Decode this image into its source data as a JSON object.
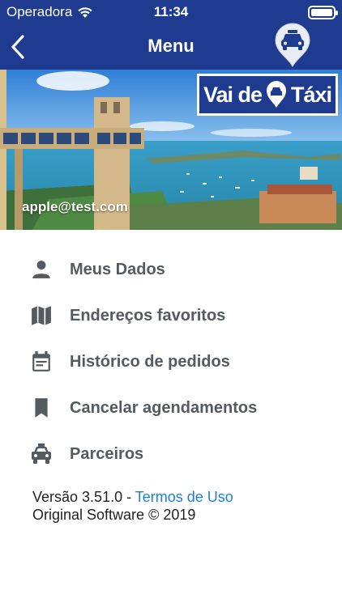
{
  "status_bar": {
    "carrier": "Operadora",
    "time": "11:34"
  },
  "nav": {
    "title": "Menu",
    "back_icon": "chevron-left-icon",
    "taxi_pin_icon": "taxi-pin-icon"
  },
  "hero": {
    "logo_text_1": "Vai de",
    "logo_text_2": "Táxi",
    "email": "apple@test.com"
  },
  "menu": {
    "items": [
      {
        "label": "Meus Dados",
        "icon": "person-icon"
      },
      {
        "label": "Endereços favoritos",
        "icon": "map-icon"
      },
      {
        "label": "Histórico de pedidos",
        "icon": "calendar-icon"
      },
      {
        "label": "Cancelar agendamentos",
        "icon": "bookmark-icon"
      },
      {
        "label": "Parceiros",
        "icon": "taxi-icon"
      }
    ]
  },
  "footer": {
    "version": "Versão 3.51.0 - ",
    "terms_link": "Termos de Uso",
    "copyright": "Original Software © 2019"
  },
  "colors": {
    "brand": "#1f3b8f",
    "link": "#1d7fd8",
    "menu_text": "#555a60"
  }
}
